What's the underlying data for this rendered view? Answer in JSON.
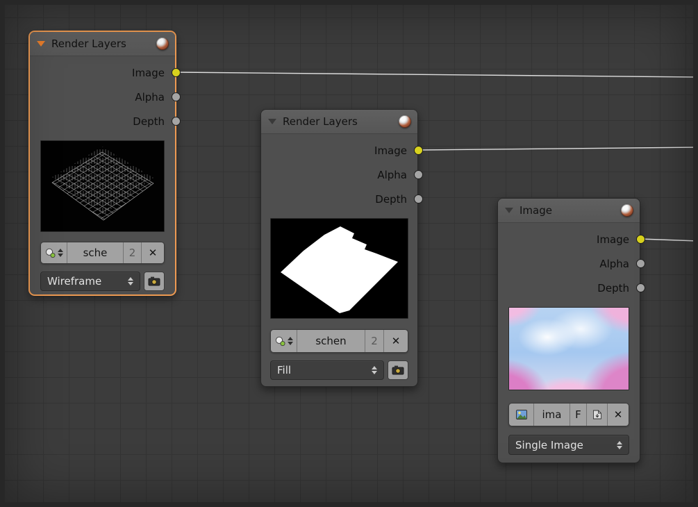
{
  "editor": {
    "background": "#3c3c3c",
    "grid_color": "#343434",
    "wire_color": "#dedede",
    "selection_color": "#ee9a52",
    "socket_image_color": "#d8d21e",
    "socket_gray_color": "#a5a5a5"
  },
  "nodes": [
    {
      "title": "Render Layers",
      "selected": true,
      "outputs": [
        {
          "label": "Image",
          "color": "#d8d21e",
          "connected": true
        },
        {
          "label": "Alpha",
          "color": "#a5a5a5",
          "connected": false
        },
        {
          "label": "Depth",
          "color": "#a5a5a5",
          "connected": false
        }
      ],
      "preview": "wireframe-render-thumbnail",
      "id_selector": {
        "icon": "browse-scene-icon",
        "name": "sche",
        "count": "2",
        "delete": "✕"
      },
      "layer_select": {
        "value": "Wireframe",
        "camera_button": true
      }
    },
    {
      "title": "Render Layers",
      "selected": false,
      "outputs": [
        {
          "label": "Image",
          "color": "#d8d21e",
          "connected": true
        },
        {
          "label": "Alpha",
          "color": "#a5a5a5",
          "connected": false
        },
        {
          "label": "Depth",
          "color": "#a5a5a5",
          "connected": false
        }
      ],
      "preview": "fill-render-thumbnail",
      "id_selector": {
        "icon": "browse-scene-icon",
        "name": "schen",
        "count": "2",
        "delete": "✕"
      },
      "layer_select": {
        "value": "Fill",
        "camera_button": true
      }
    },
    {
      "title": "Image",
      "selected": false,
      "outputs": [
        {
          "label": "Image",
          "color": "#d8d21e",
          "connected": true
        },
        {
          "label": "Alpha",
          "color": "#a5a5a5",
          "connected": false
        },
        {
          "label": "Depth",
          "color": "#a5a5a5",
          "connected": false
        }
      ],
      "preview": "cherry-blossom-photo-thumbnail",
      "id_selector": {
        "icon": "image-icon",
        "name": "ima",
        "fake_user": "F",
        "pack_icon": "pack-icon",
        "delete": "✕"
      },
      "source_select": {
        "value": "Single Image"
      }
    }
  ],
  "icons": {
    "collapse_triangle": "▼",
    "material_ball": "shaded-sphere",
    "browse_scene": "datablock-spheres-with-arrows",
    "camera": "re-render-camera",
    "image": "photo-landscape",
    "pack": "pack-file",
    "delete": "✕"
  }
}
